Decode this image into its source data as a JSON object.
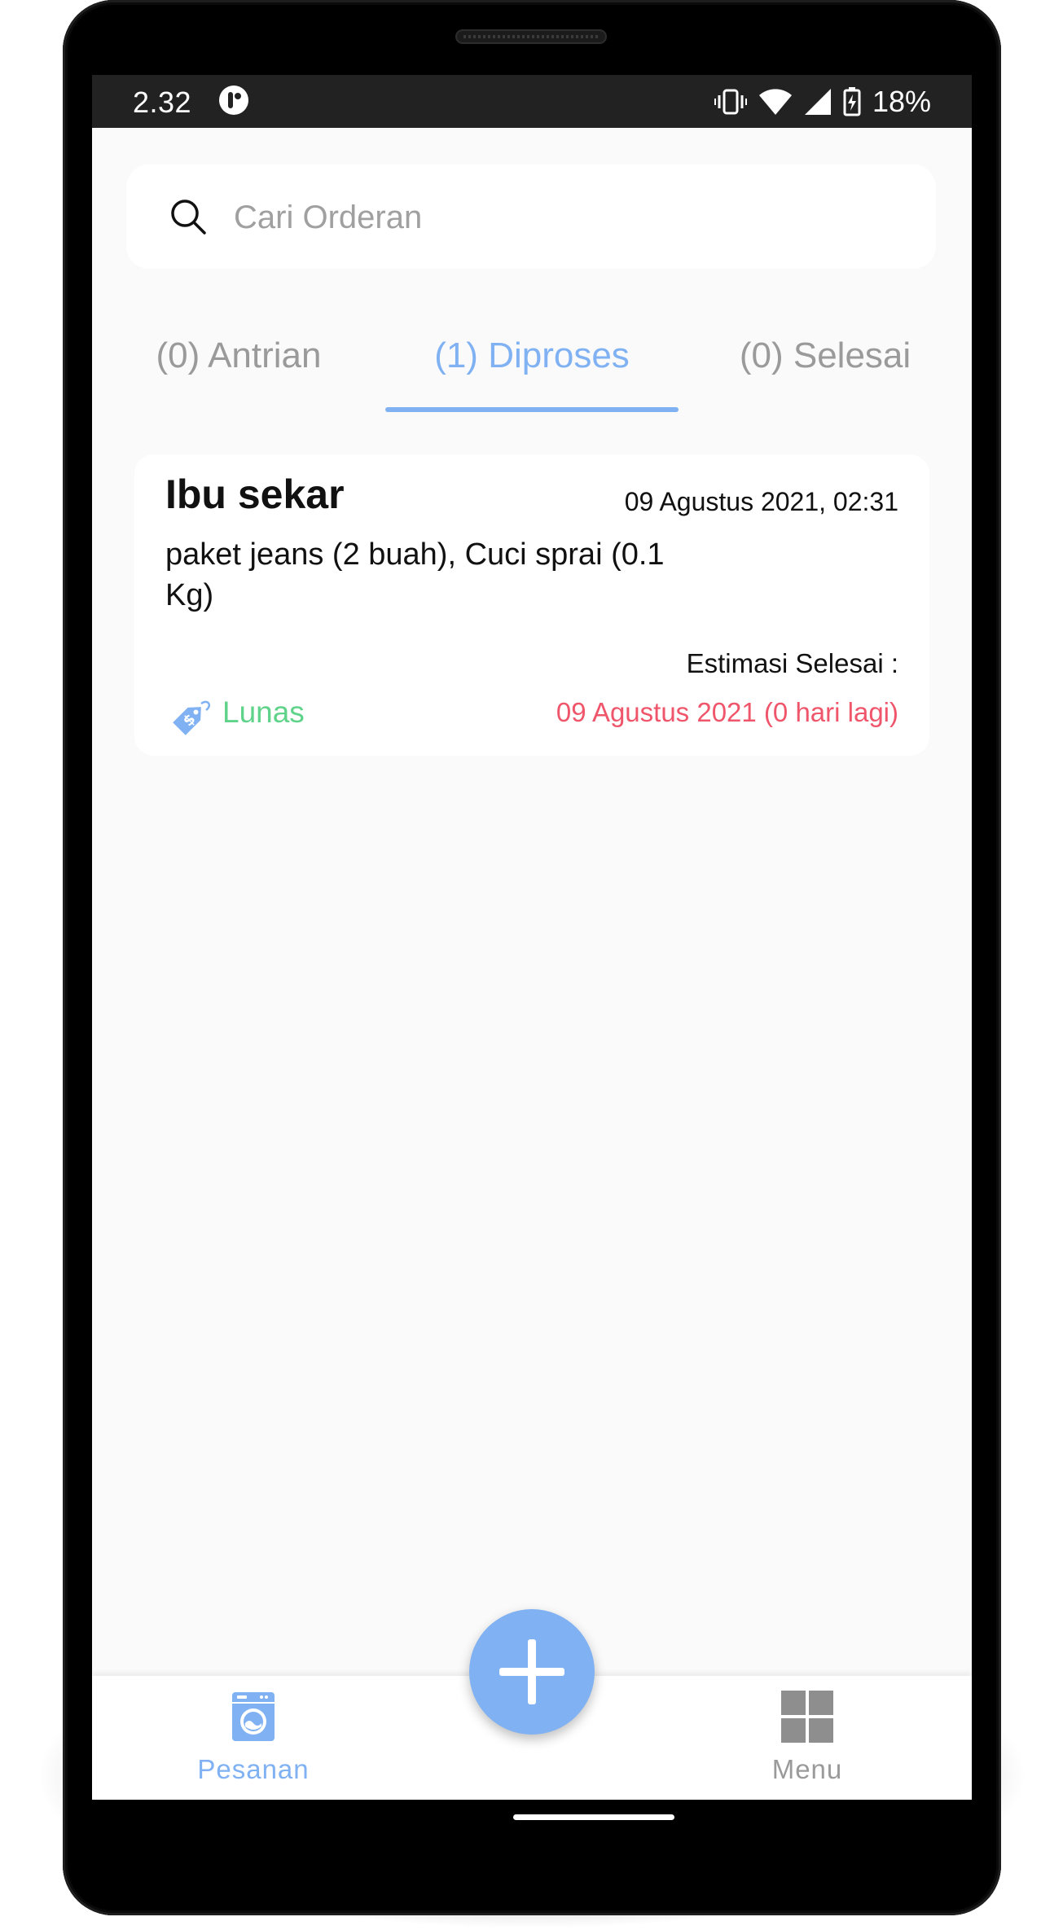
{
  "status_bar": {
    "time": "2.32",
    "battery": "18%"
  },
  "search": {
    "placeholder": "Cari Orderan"
  },
  "tabs": [
    {
      "label": "(0) Antrian",
      "active": false
    },
    {
      "label": "(1) Diproses",
      "active": true
    },
    {
      "label": "(0) Selesai",
      "active": false
    }
  ],
  "orders": [
    {
      "customer": "Ibu sekar",
      "date": "09 Agustus 2021, 02:31",
      "items": "paket jeans (2 buah), Cuci sprai (0.1 Kg)",
      "payment_status": "Lunas",
      "estimate_label": "Estimasi Selesai :",
      "estimate_date": "09 Agustus 2021 (0 hari lagi)"
    }
  ],
  "bottom_nav": [
    {
      "label": "Pesanan",
      "icon": "washing-machine-icon",
      "active": true
    },
    {
      "label": "Menu",
      "icon": "grid-icon",
      "active": false
    }
  ],
  "fab": {
    "icon": "plus-icon"
  },
  "colors": {
    "accent": "#7fb1f3",
    "paid": "#5fd38a",
    "deadline": "#f0566b",
    "inactive": "#9a9a9a"
  }
}
